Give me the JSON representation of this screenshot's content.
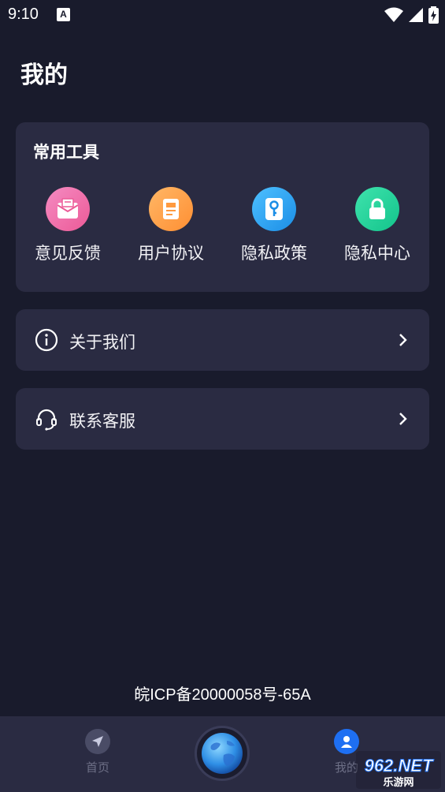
{
  "status_bar": {
    "time": "9:10",
    "notification_glyph": "A"
  },
  "page": {
    "title": "我的"
  },
  "tools": {
    "title": "常用工具",
    "items": [
      {
        "label": "意见反馈",
        "icon": "mail-icon",
        "color": "#f06aa8"
      },
      {
        "label": "用户协议",
        "icon": "document-icon",
        "color": "#ffa24a"
      },
      {
        "label": "隐私政策",
        "icon": "key-icon",
        "color": "#2ea6f2"
      },
      {
        "label": "隐私中心",
        "icon": "lock-icon",
        "color": "#25d39a"
      }
    ]
  },
  "menu": {
    "about": {
      "label": "关于我们",
      "icon": "info-icon"
    },
    "service": {
      "label": "联系客服",
      "icon": "headset-icon"
    }
  },
  "footer": {
    "icp": "皖ICP备20000058号-65A"
  },
  "bottom_nav": {
    "home": {
      "label": "首页",
      "icon": "navigation-arrow-icon"
    },
    "center": {
      "icon": "globe-icon"
    },
    "mine": {
      "label": "我的",
      "icon": "user-icon"
    }
  },
  "watermark": {
    "text": "962.NET",
    "subtext": "乐游网"
  }
}
